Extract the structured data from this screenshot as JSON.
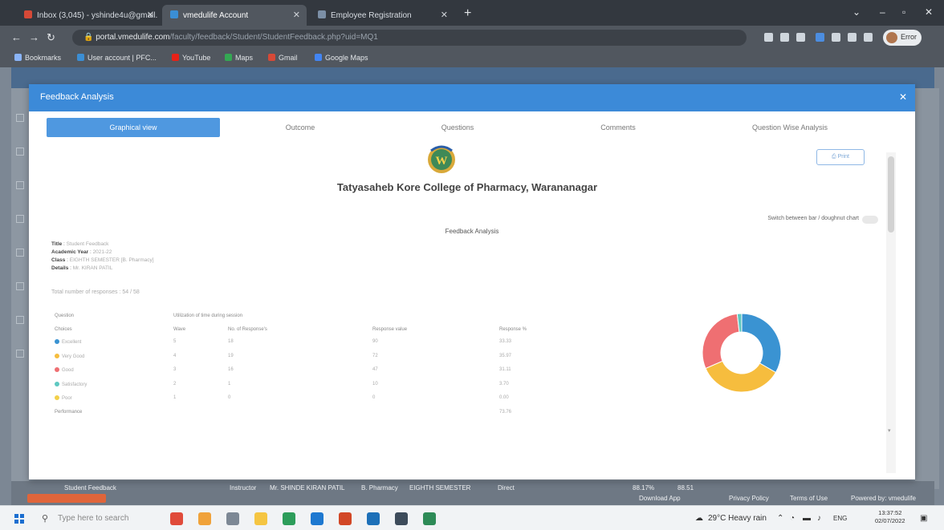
{
  "browser": {
    "tabs": [
      {
        "label": "Inbox (3,045) - yshinde4u@gmail.",
        "fav_color": "#d64937"
      },
      {
        "label": "vmedulife Account",
        "fav_color": "#3b8ed4"
      },
      {
        "label": "Employee Registration",
        "fav_color": "#7b8fa6"
      }
    ],
    "url_host": "portal.vmedulife.com",
    "url_path": "/faculty/feedback/Student/StudentFeedback.php?uid=MQ1",
    "profile_label": "Error",
    "bookmarks": [
      {
        "label": "Bookmarks",
        "color": "#8ab4f8"
      },
      {
        "label": "User account | PFC...",
        "color": "#3b8ed4"
      },
      {
        "label": "YouTube",
        "color": "#e62117"
      },
      {
        "label": "Maps",
        "color": "#34a853"
      },
      {
        "label": "Gmail",
        "color": "#d64937"
      },
      {
        "label": "Google Maps",
        "color": "#4285f4"
      }
    ]
  },
  "modal": {
    "title": "Feedback Analysis",
    "tabs": [
      "Graphical view",
      "Outcome",
      "Questions",
      "Comments",
      "Question Wise Analysis"
    ],
    "active_tab": 0,
    "college_name": "Tatyasaheb Kore College of Pharmacy, Warananagar",
    "logo_letter": "W",
    "print_label": "Print",
    "switch_label": "Switch between bar / doughnut chart",
    "analysis_title": "Feedback Analysis",
    "meta": [
      {
        "label": "Title",
        "value": "Student Feedback"
      },
      {
        "label": "Academic Year",
        "value": "2021-22"
      },
      {
        "label": "Class",
        "value": "EIGHTH SEMESTER [B. Pharmacy]"
      },
      {
        "label": "Details",
        "value": "Mr. KIRAN PATIL"
      }
    ],
    "responses_label": "Total number of responses :",
    "responses_value": "54 / 58"
  },
  "chart_data": {
    "type": "pie",
    "columns": [
      "Choices",
      "Wave",
      "No. of Response's",
      "Response value",
      "Response %"
    ],
    "section_label": "Question",
    "caption": "Utilization of time during session",
    "categories": [
      "Excellent",
      "Very Good",
      "Good",
      "Satisfactory",
      "Poor"
    ],
    "wave": [
      "5",
      "4",
      "3",
      "2",
      "1"
    ],
    "responses": [
      "18",
      "19",
      "16",
      "1",
      "0"
    ],
    "response_value": [
      "90",
      "72",
      "47",
      "10",
      "0"
    ],
    "response_pct": [
      "33.33",
      "35.97",
      "31.11",
      "3.70",
      "0.00"
    ],
    "values": [
      18,
      19,
      16,
      1,
      0
    ],
    "colors": [
      "#3a93d2",
      "#f6bd3e",
      "#ef6f72",
      "#5ec8c1",
      "#f3d04a"
    ],
    "performance_label": "Performance",
    "performance_value": "73.76"
  },
  "background_page": {
    "footer_cells": [
      "Student Feedback",
      "Instructor",
      "Mr. SHINDE KIRAN PATIL",
      "B. Pharmacy",
      "EIGHTH SEMESTER",
      "Direct",
      "88.17%",
      "88.51"
    ],
    "footer_links": [
      "Download App",
      "Privacy Policy",
      "Terms of Use",
      "Powered by: vmedulife"
    ]
  },
  "taskbar": {
    "search_placeholder": "Type here to search",
    "app_colors": [
      "#e04b3a",
      "#f0a23a",
      "#7d8895",
      "#f5c542",
      "#2d9d5a",
      "#1d78d0",
      "#d24726",
      "#1d70b8",
      "#3d4b5a",
      "#2e8b57"
    ],
    "weather": "29°C Heavy rain",
    "lang": "ENG",
    "time": "13:37:52",
    "date": "02/07/2022"
  }
}
